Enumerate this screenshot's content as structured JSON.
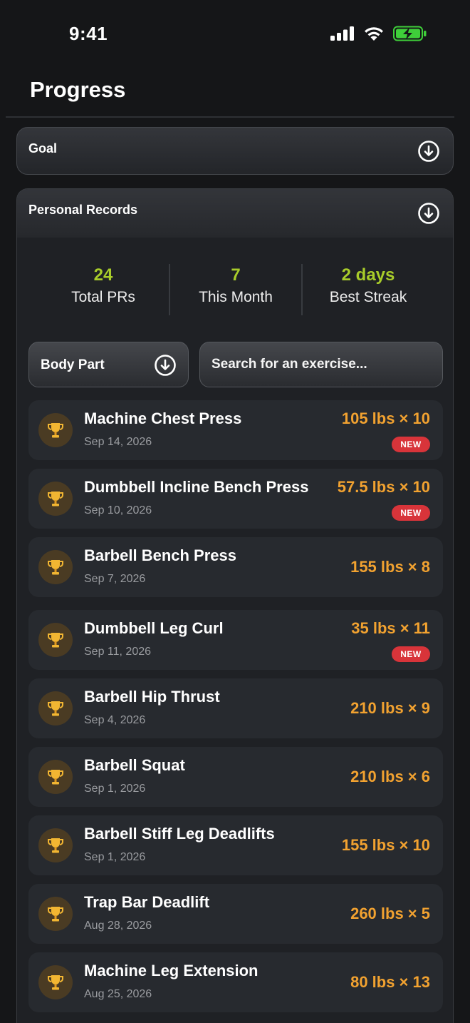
{
  "status": {
    "time": "9:41",
    "icons": [
      "signal-icon",
      "wifi-icon",
      "battery-charging-icon"
    ],
    "battery_color": "#3fcf3a"
  },
  "page": {
    "title": "Progress"
  },
  "goal": {
    "label": "Goal"
  },
  "personal_records": {
    "label": "Personal Records",
    "stats": [
      {
        "value": "24",
        "label": "Total PRs"
      },
      {
        "value": "7",
        "label": "This Month"
      },
      {
        "value": "2 days",
        "label": "Best Streak"
      }
    ],
    "filter": {
      "label": "Body Part"
    },
    "search": {
      "placeholder": "Search for an exercise..."
    },
    "records": [
      {
        "name": "Machine Chest Press",
        "date": "Sep 14, 2026",
        "value": "105 lbs × 10",
        "badge": "NEW"
      },
      {
        "name": "Dumbbell Incline Bench Press",
        "date": "Sep 10, 2026",
        "value": "57.5 lbs × 10",
        "badge": "NEW"
      },
      {
        "name": "Barbell Bench Press",
        "date": "Sep 7, 2026",
        "value": "155 lbs × 8",
        "badge": ""
      },
      {
        "name": "Dumbbell Leg Curl",
        "date": "Sep 11, 2026",
        "value": "35 lbs × 11",
        "badge": "NEW"
      },
      {
        "name": "Barbell Hip Thrust",
        "date": "Sep 4, 2026",
        "value": "210 lbs × 9",
        "badge": ""
      },
      {
        "name": "Barbell Squat",
        "date": "Sep 1, 2026",
        "value": "210 lbs × 6",
        "badge": ""
      },
      {
        "name": "Barbell Stiff Leg Deadlifts",
        "date": "Sep 1, 2026",
        "value": "155 lbs × 10",
        "badge": ""
      },
      {
        "name": "Trap Bar Deadlift",
        "date": "Aug 28, 2026",
        "value": "260 lbs × 5",
        "badge": ""
      },
      {
        "name": "Machine Leg Extension",
        "date": "Aug 25, 2026",
        "value": "80 lbs × 13",
        "badge": ""
      }
    ]
  },
  "colors": {
    "accent_green": "#a8cc2a",
    "value_orange": "#f2a230",
    "badge_red": "#d8343a"
  }
}
